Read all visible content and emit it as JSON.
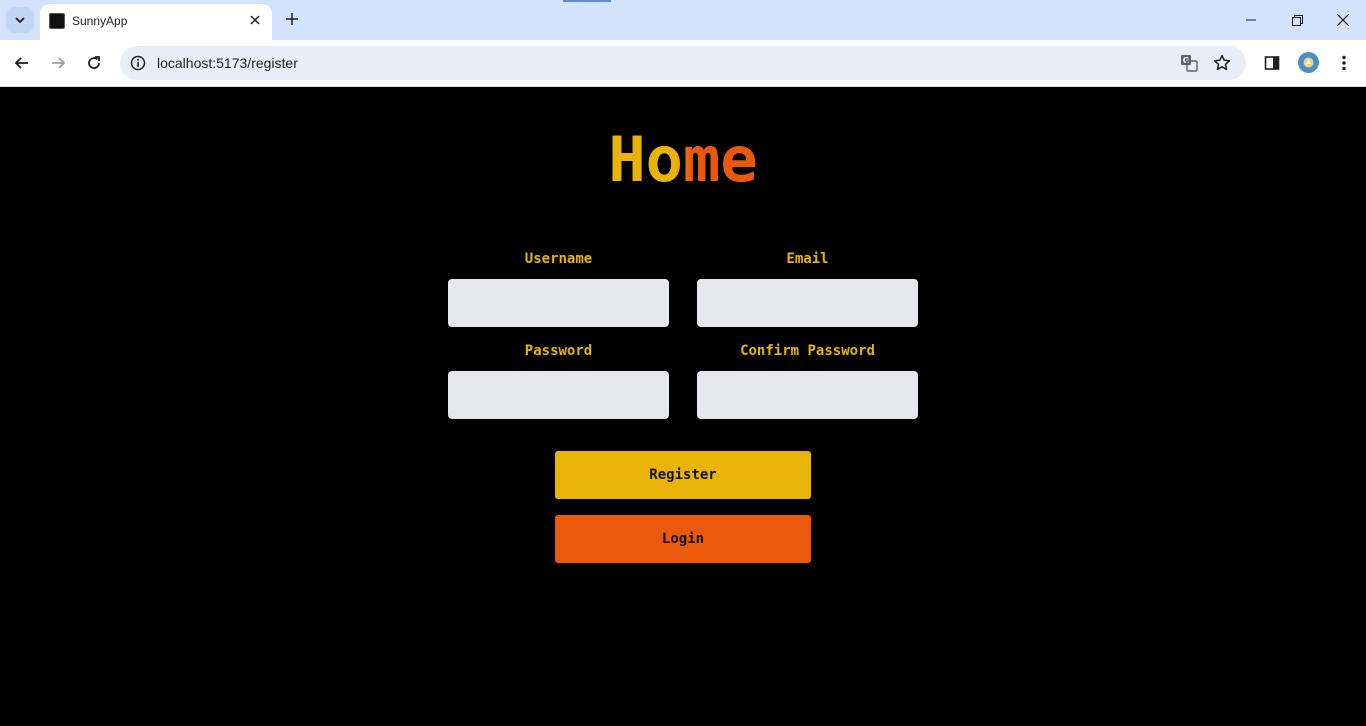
{
  "browser": {
    "tab_title": "SunnyApp",
    "url": "localhost:5173/register"
  },
  "icons": {
    "tab_search": "chevron-down-icon",
    "tab_close": "close-icon",
    "new_tab": "plus-icon",
    "minimize": "minimize-icon",
    "restore": "restore-icon",
    "close_window": "close-icon",
    "back": "arrow-left-icon",
    "forward": "arrow-right-icon",
    "reload": "reload-icon",
    "site_info": "info-icon",
    "translate": "translate-icon",
    "bookmark": "star-icon",
    "side_panel": "side-panel-icon",
    "profile": "avatar-icon",
    "menu": "kebab-menu-icon"
  },
  "page": {
    "title": "Home",
    "form": {
      "username_label": "Username",
      "email_label": "Email",
      "password_label": "Password",
      "confirm_password_label": "Confirm Password",
      "username_value": "",
      "email_value": "",
      "password_value": "",
      "confirm_password_value": ""
    },
    "register_button": "Register",
    "login_button": "Login"
  },
  "colors": {
    "background": "#000000",
    "accent_yellow": "#eab308",
    "accent_orange": "#ea580c",
    "input_background": "#e5e7eb",
    "chrome_tabstrip": "#d3e3fd"
  }
}
